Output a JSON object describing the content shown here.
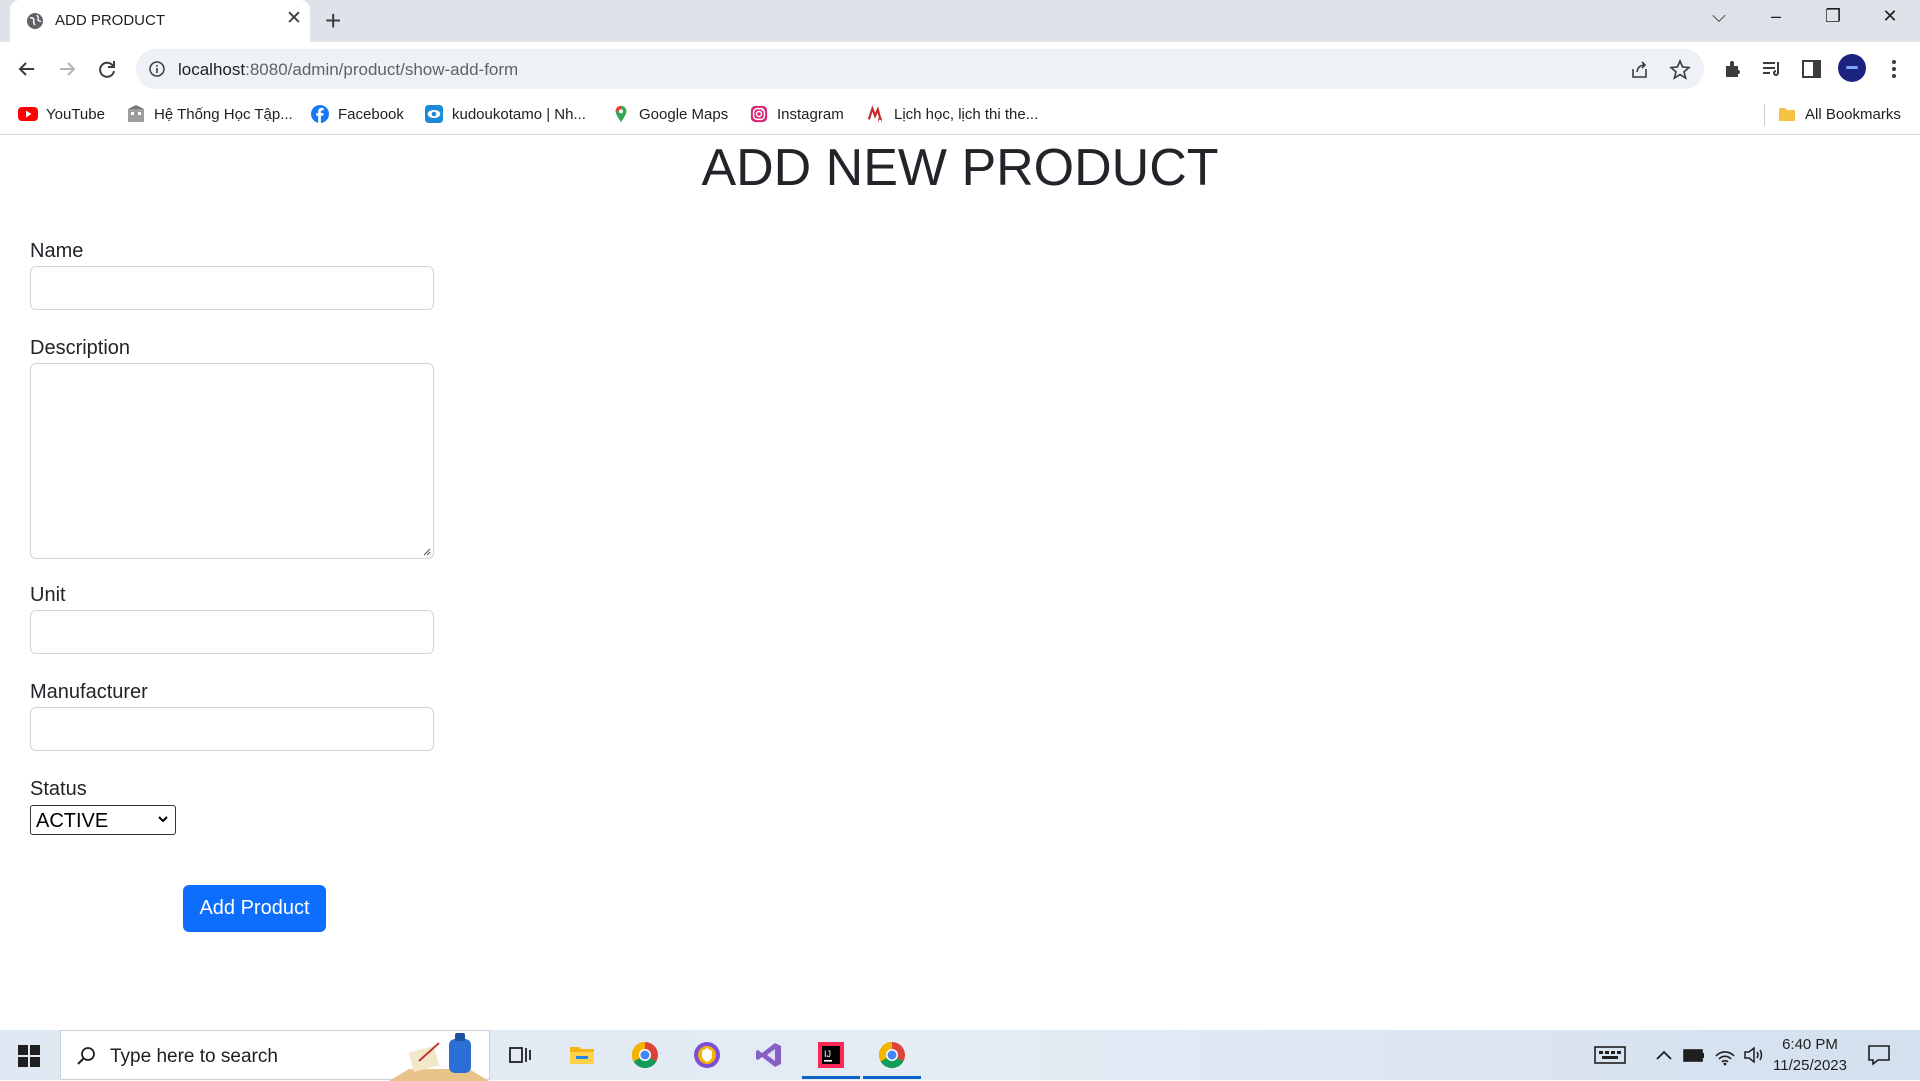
{
  "browser": {
    "tab_title": "ADD PRODUCT",
    "url_host": "localhost",
    "url_rest": ":8080/admin/product/show-add-form",
    "bookmarks": [
      {
        "label": "YouTube",
        "icon": "youtube-icon"
      },
      {
        "label": "Hệ Thống Học Tập...",
        "icon": "school-icon"
      },
      {
        "label": "Facebook",
        "icon": "facebook-icon"
      },
      {
        "label": "kudoukotamo | Nh...",
        "icon": "eye-icon"
      },
      {
        "label": "Google Maps",
        "icon": "maps-pin-icon"
      },
      {
        "label": "Instagram",
        "icon": "instagram-icon"
      },
      {
        "label": "Lịch học, lịch thi the...",
        "icon": "university-icon"
      }
    ],
    "all_bookmarks": "All Bookmarks"
  },
  "page": {
    "title": "ADD NEW PRODUCT",
    "form": {
      "name_label": "Name",
      "name_value": "",
      "description_label": "Description",
      "description_value": "",
      "unit_label": "Unit",
      "unit_value": "",
      "manufacturer_label": "Manufacturer",
      "manufacturer_value": "",
      "status_label": "Status",
      "status_selected": "ACTIVE",
      "submit_label": "Add Product"
    }
  },
  "taskbar": {
    "search_placeholder": "Type here to search",
    "time": "6:40 PM",
    "date": "11/25/2023"
  },
  "colors": {
    "primary_button": "#0d6efd",
    "tabstrip_bg": "#dee3ea"
  }
}
